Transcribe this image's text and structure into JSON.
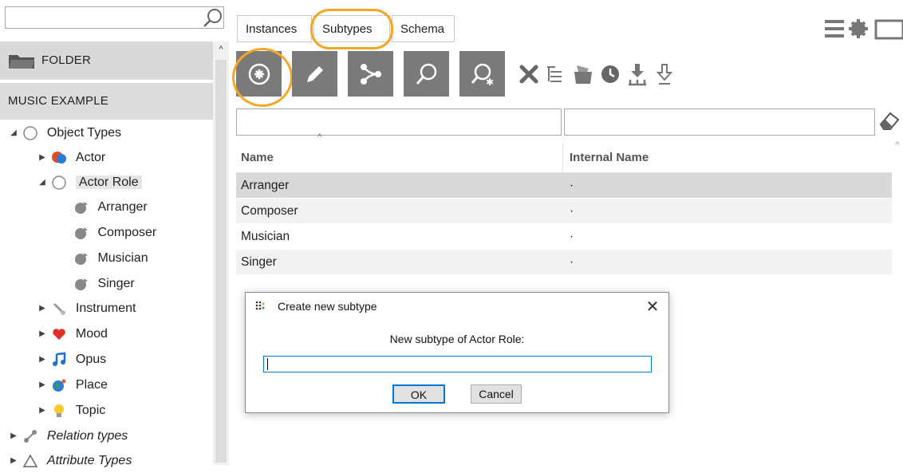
{
  "search": {
    "placeholder": ""
  },
  "sidebar": {
    "folder_label": "FOLDER",
    "section_label": "MUSIC EXAMPLE",
    "tree": {
      "object_types": "Object Types",
      "actor": "Actor",
      "actor_role": "Actor Role",
      "arranger": "Arranger",
      "composer": "Composer",
      "musician": "Musician",
      "singer": "Singer",
      "instrument": "Instrument",
      "mood": "Mood",
      "opus": "Opus",
      "place": "Place",
      "topic": "Topic",
      "relation_types": "Relation types",
      "attribute_types": "Attribute Types"
    }
  },
  "tabs": {
    "instances": "Instances",
    "subtypes": "Subtypes",
    "schema": "Schema"
  },
  "toolbar": {
    "buttons": [
      "add-subtype-icon",
      "edit-icon",
      "hierarchy-icon",
      "search-icon",
      "search-advanced-icon"
    ],
    "small_tools": [
      "delete-icon",
      "tree-list-icon",
      "archive-icon",
      "history-icon",
      "import-icon",
      "export-icon"
    ],
    "accent_color": "#f5a623"
  },
  "table": {
    "columns": {
      "name": "Name",
      "internal_name": "Internal Name"
    },
    "rows": [
      {
        "name": "Arranger",
        "internal_name": "·"
      },
      {
        "name": "Composer",
        "internal_name": "·"
      },
      {
        "name": "Musician",
        "internal_name": "·"
      },
      {
        "name": "Singer",
        "internal_name": "·"
      }
    ]
  },
  "dialog": {
    "title": "Create new subtype",
    "prompt": "New subtype of Actor Role:",
    "input_value": "",
    "ok_label": "OK",
    "cancel_label": "Cancel"
  }
}
